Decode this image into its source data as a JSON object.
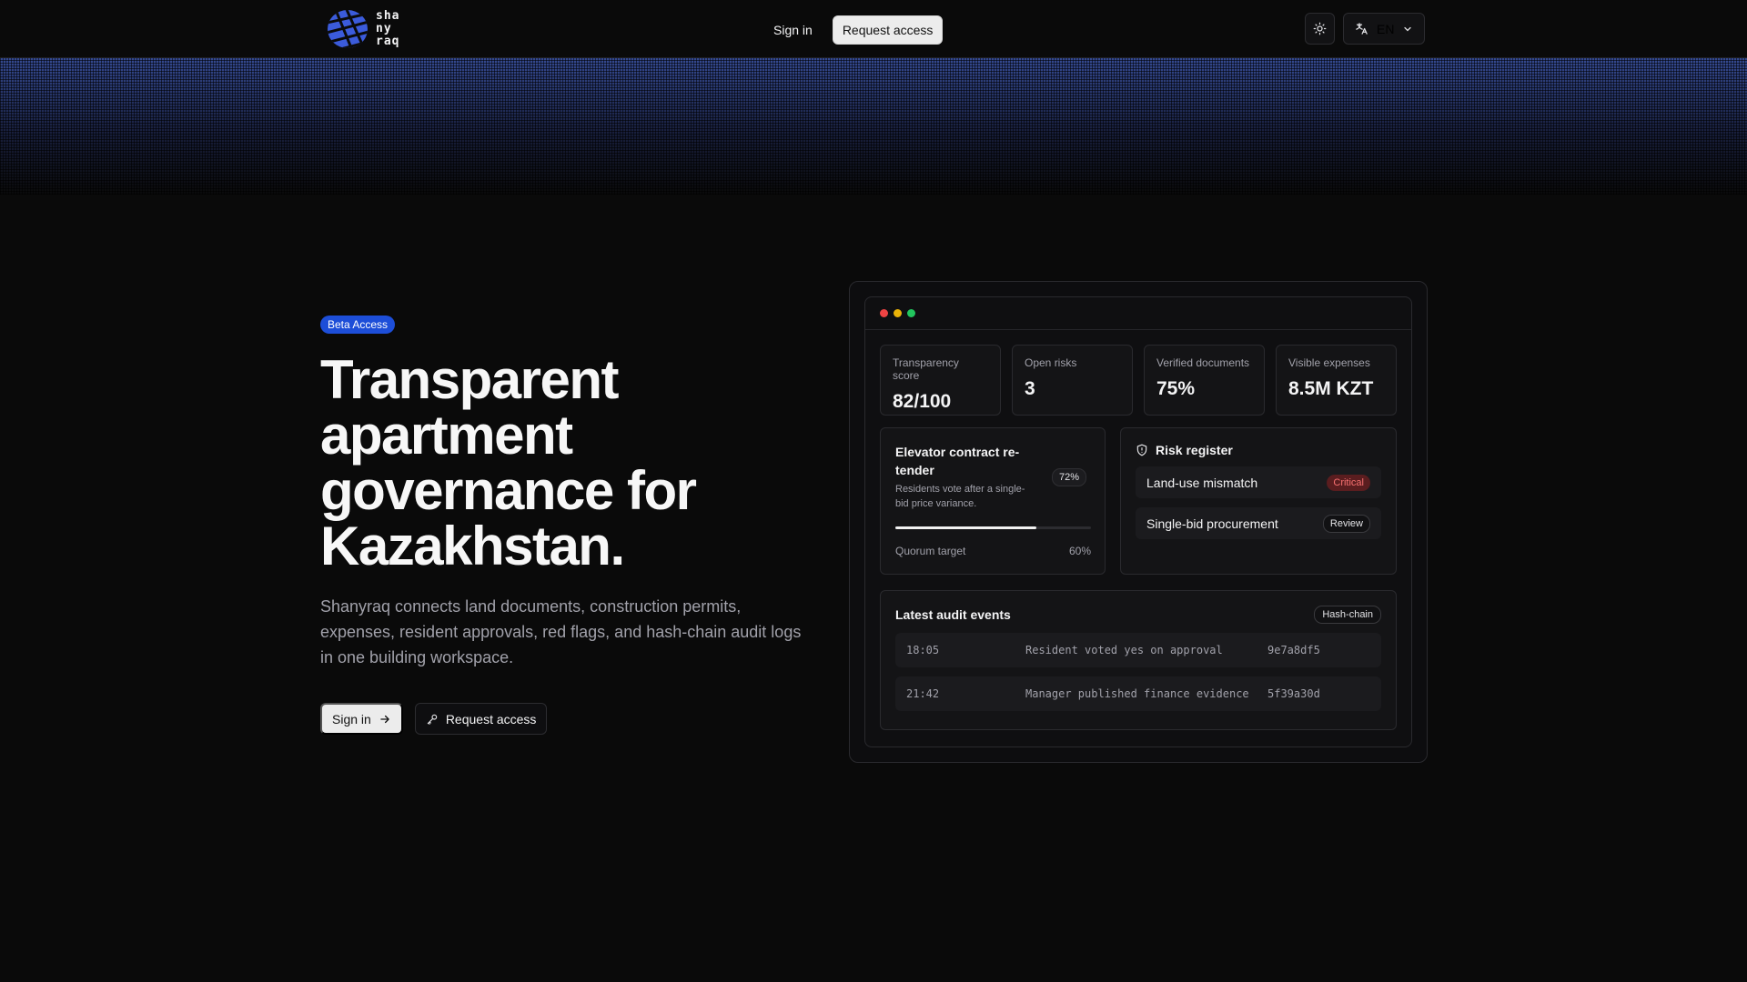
{
  "brand": {
    "logo_lines": [
      "sha",
      "ny",
      "raq"
    ],
    "logo_color": "#3b5bdb"
  },
  "header": {
    "nav_sign_in": "Sign in",
    "nav_request_access": "Request access",
    "theme_icon": "sun-icon",
    "language_icon": "translate-icon",
    "language": "EN"
  },
  "hero": {
    "badge": "Beta Access",
    "title_lines": [
      "Transparent",
      "apartment",
      "governance for",
      "Kazakhstan."
    ],
    "description": "Shanyraq connects land documents, construction permits, expenses, resident approvals, red flags, and hash-chain audit logs in one building workspace.",
    "cta_sign_in": "Sign in",
    "cta_request_access": "Request access"
  },
  "dashboard": {
    "window_dots": [
      "#ef4444",
      "#eab308",
      "#22c55e"
    ],
    "stats": [
      {
        "label": "Transparency score",
        "value": "82/100"
      },
      {
        "label": "Open risks",
        "value": "3"
      },
      {
        "label": "Verified documents",
        "value": "75%"
      },
      {
        "label": "Visible expenses",
        "value": "8.5M KZT"
      }
    ],
    "vote": {
      "title": "Elevator contract re-tender",
      "subtitle": "Residents vote after a single-bid price variance.",
      "percent": "72%",
      "progress": 0.72,
      "quorum_label": "Quorum target",
      "quorum_value": "60%"
    },
    "risk_register": {
      "title": "Risk register",
      "items": [
        {
          "name": "Land-use mismatch",
          "status": "Critical"
        },
        {
          "name": "Single-bid procurement",
          "status": "Review"
        }
      ]
    },
    "audit": {
      "title": "Latest audit events",
      "tag": "Hash-chain",
      "events": [
        {
          "time": "18:05",
          "event": "Resident voted yes on approval",
          "hash": "9e7a8df5"
        },
        {
          "time": "21:42",
          "event": "Manager published finance evidence",
          "hash": "5f39a30d"
        }
      ]
    }
  }
}
